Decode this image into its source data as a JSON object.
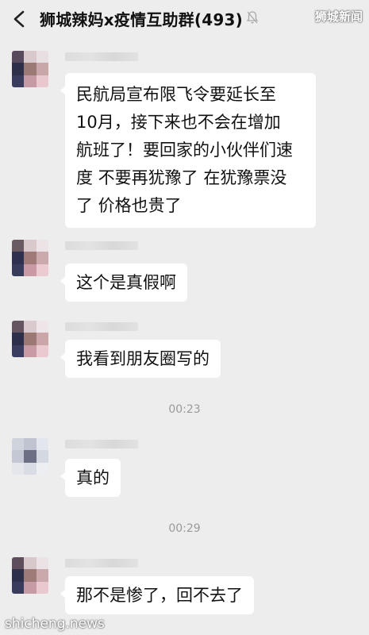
{
  "header": {
    "title": "狮城辣妈x疫情互助群(493)",
    "watermark": "狮城新闻"
  },
  "messages": [
    {
      "text_lines": [
        "民航局宣布限飞令要延长至",
        "10月，接下来也不会在增加",
        "航班了！要回家的小伙伴们速",
        "度 不要再犹豫了 在犹豫票没",
        "了 价格也贵了"
      ]
    },
    {
      "text": "这个是真假啊"
    },
    {
      "text": "我看到朋友圈写的"
    },
    {
      "text": "真的"
    },
    {
      "text": "那不是惨了，回不去了"
    }
  ],
  "timestamps": [
    "00:23",
    "00:29"
  ],
  "footer_watermark": "shicheng.news",
  "colors": {
    "background": "#ededed",
    "bubble": "#ffffff",
    "timestamp": "#9a9a9a"
  }
}
